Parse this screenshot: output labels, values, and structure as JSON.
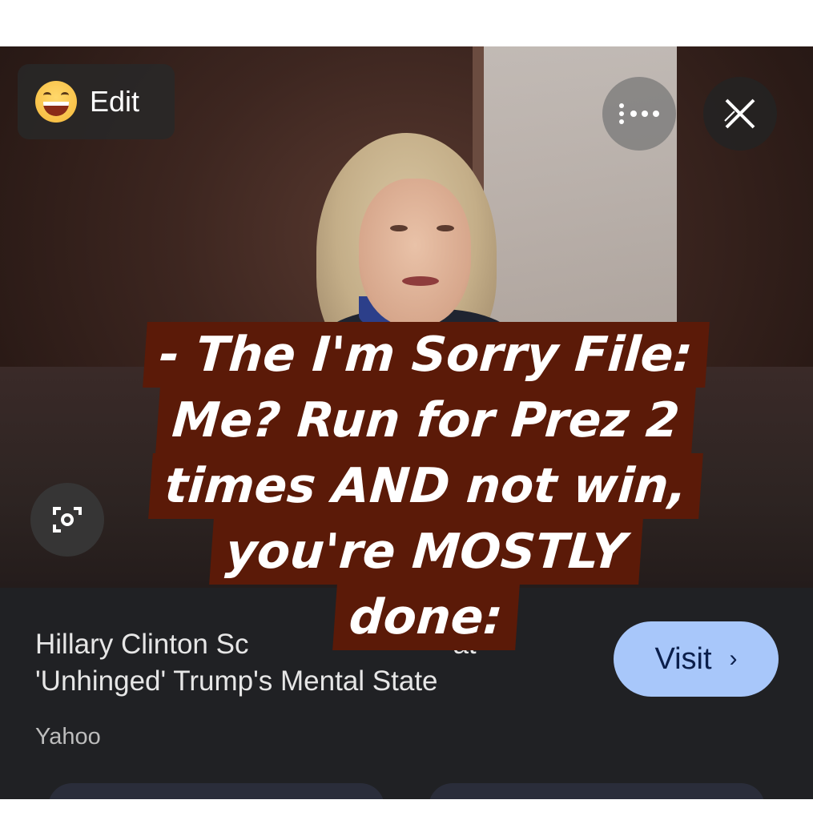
{
  "toolbar": {
    "edit_label": "Edit",
    "edit_icon": "grinning-face-emoji",
    "more_icon": "more-options-icon",
    "close_icon": "close-icon"
  },
  "lens": {
    "icon": "lens-search-icon"
  },
  "result": {
    "title_line1": "Hillary Clinton Sc",
    "title_line1_end": "at",
    "title_line2": "'Unhinged' Trump's Mental State",
    "source": "Yahoo",
    "visit_label": "Visit",
    "visit_icon": "chevron-right-icon"
  },
  "overlay_text": {
    "line1": "- The I'm Sorry File:",
    "line2": "Me?  Run for Prez 2",
    "line3": "times AND not win,",
    "line4": "you're MOSTLY",
    "line5": "done:"
  },
  "colors": {
    "overlay_bg": "#5b1a08",
    "visit_button": "#a8c7fa",
    "panel_bg": "#202124"
  }
}
